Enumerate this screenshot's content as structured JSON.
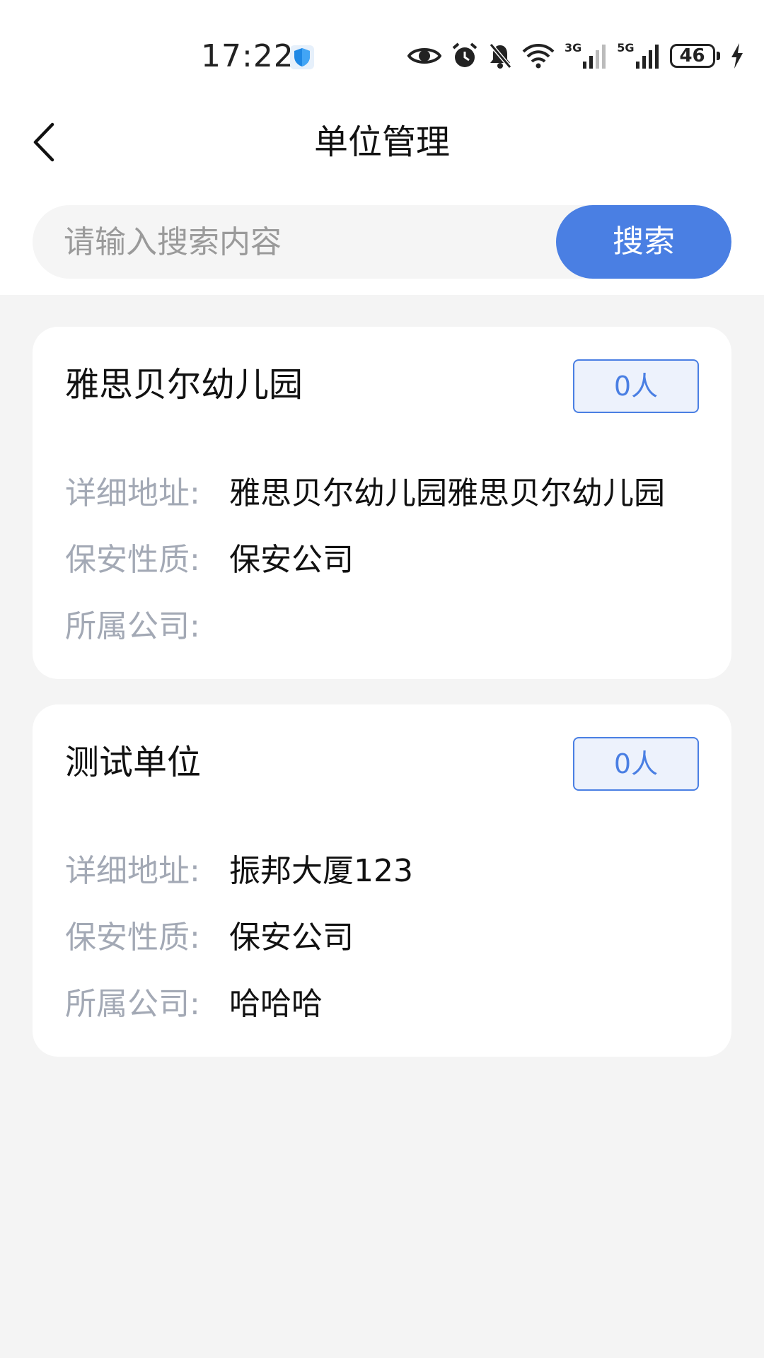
{
  "status_bar": {
    "time": "17:22",
    "net_3g": "3G",
    "net_5g": "5G",
    "battery": "46"
  },
  "header": {
    "title": "单位管理"
  },
  "search": {
    "placeholder": "请输入搜索内容",
    "value": "",
    "button_label": "搜索"
  },
  "units": [
    {
      "name": "雅思贝尔幼儿园",
      "count": "0人",
      "address_label": "详细地址:",
      "address": "雅思贝尔幼儿园雅思贝尔幼儿园",
      "nature_label": "保安性质:",
      "nature": "保安公司",
      "company_label": "所属公司:",
      "company": ""
    },
    {
      "name": "测试单位",
      "count": "0人",
      "address_label": "详细地址:",
      "address": "振邦大厦123",
      "nature_label": "保安性质:",
      "nature": "保安公司",
      "company_label": "所属公司:",
      "company": "哈哈哈"
    }
  ],
  "colors": {
    "accent": "#4a7fe3",
    "badge_bg": "#edf2fc",
    "label_gray": "#a3a9b5",
    "page_bg": "#f4f4f4"
  }
}
